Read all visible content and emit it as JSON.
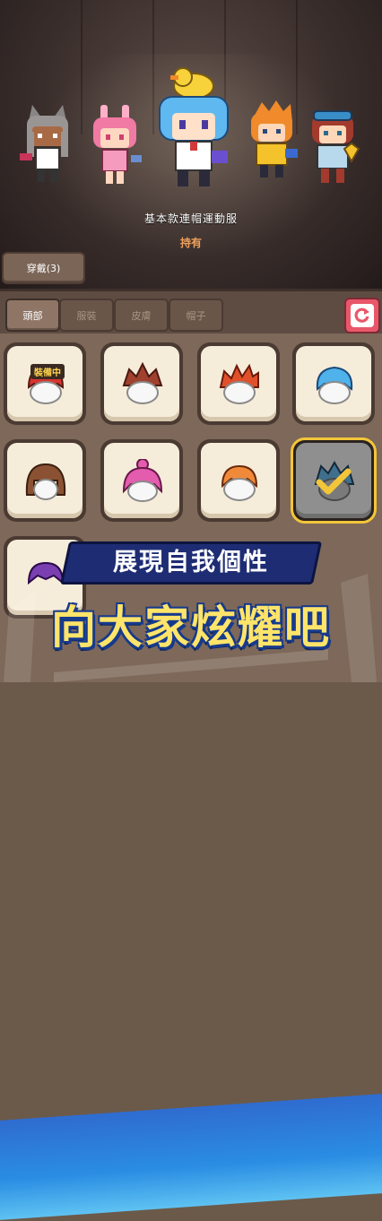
{
  "preview": {
    "outfit_name": "基本款連帽運動服",
    "status": "持有",
    "wear_button_label": "穿戴(3)"
  },
  "tabs": [
    {
      "label": "頭部",
      "active": true
    },
    {
      "label": "服裝",
      "active": false
    },
    {
      "label": "皮膚",
      "active": false
    },
    {
      "label": "帽子",
      "active": false
    }
  ],
  "reset_icon": "refresh-icon",
  "items": [
    {
      "name": "white-hair",
      "color": "#f2f2f2",
      "equipped": true,
      "badge": "裝備中"
    },
    {
      "name": "brown-spiky-hair",
      "color": "#a0402e"
    },
    {
      "name": "red-spiky-hair",
      "color": "#e0502a"
    },
    {
      "name": "blue-hair",
      "color": "#4fb2ea"
    },
    {
      "name": "brown-bob-hair",
      "color": "#8a5233"
    },
    {
      "name": "pink-bun-hair",
      "color": "#e45cae"
    },
    {
      "name": "orange-hair",
      "color": "#f08a3a"
    },
    {
      "name": "dark-spiky-hair",
      "color": "#3f6f8c",
      "selected": true
    },
    {
      "name": "purple-hair",
      "color": "#7a3fb0"
    }
  ],
  "banner": {
    "line1": "展現自我個性",
    "line2": "向大家炫耀吧"
  },
  "colors": {
    "accent_gold": "#f3c63a",
    "reset_red": "#e8586a",
    "owned_orange": "#f0a15a",
    "banner_blue": "#2a8de3"
  }
}
